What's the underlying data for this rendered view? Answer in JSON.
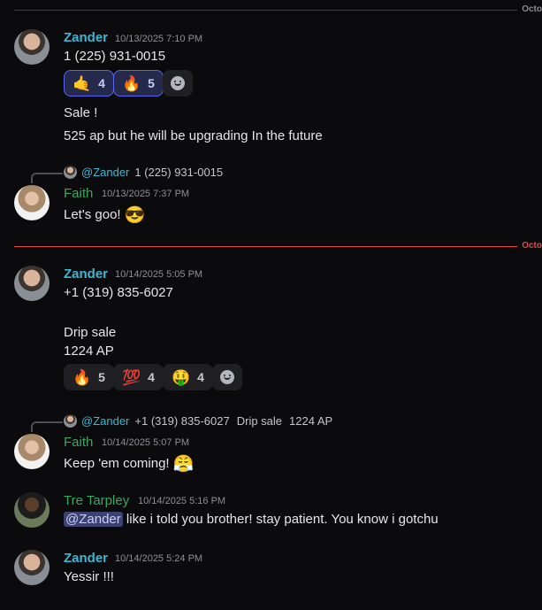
{
  "dividers": {
    "first": "Octo",
    "second": "Octo"
  },
  "messages": [
    {
      "author": "Zander",
      "timestamp": "10/13/2025 7:10 PM",
      "lines": [
        "1 (225) 931-0015",
        "Sale !",
        "525 ap but he will be upgrading In the future"
      ],
      "reactions": [
        {
          "emoji": "🤙",
          "count": "4"
        },
        {
          "emoji": "🔥",
          "count": "5"
        }
      ]
    },
    {
      "author": "Faith",
      "timestamp": "10/13/2025 7:37 PM",
      "reply": {
        "mention": "@Zander",
        "text": "1 (225) 931-0015"
      },
      "text": "Let's goo!",
      "emoji": "😎"
    },
    {
      "author": "Zander",
      "timestamp": "10/14/2025 5:05 PM",
      "lines": [
        "+1 (319) 835-6027",
        "Drip sale",
        "1224 AP"
      ],
      "reactions": [
        {
          "emoji": "🔥",
          "count": "5"
        },
        {
          "emoji": "💯",
          "count": "4"
        },
        {
          "emoji": "🤑",
          "count": "4"
        }
      ]
    },
    {
      "author": "Faith",
      "timestamp": "10/14/2025 5:07 PM",
      "reply": {
        "mention": "@Zander",
        "parts": [
          "+1 (319) 835-6027",
          "Drip sale",
          "1224 AP"
        ]
      },
      "text": "Keep 'em coming!",
      "emoji": "😤"
    },
    {
      "author": "Tre Tarpley",
      "timestamp": "10/14/2025 5:16 PM",
      "mention": "@Zander",
      "text": " like i told you brother! stay patient. You know i gotchu"
    },
    {
      "author": "Zander",
      "timestamp": "10/14/2025 5:24 PM",
      "text": "Yessir !!!"
    }
  ]
}
